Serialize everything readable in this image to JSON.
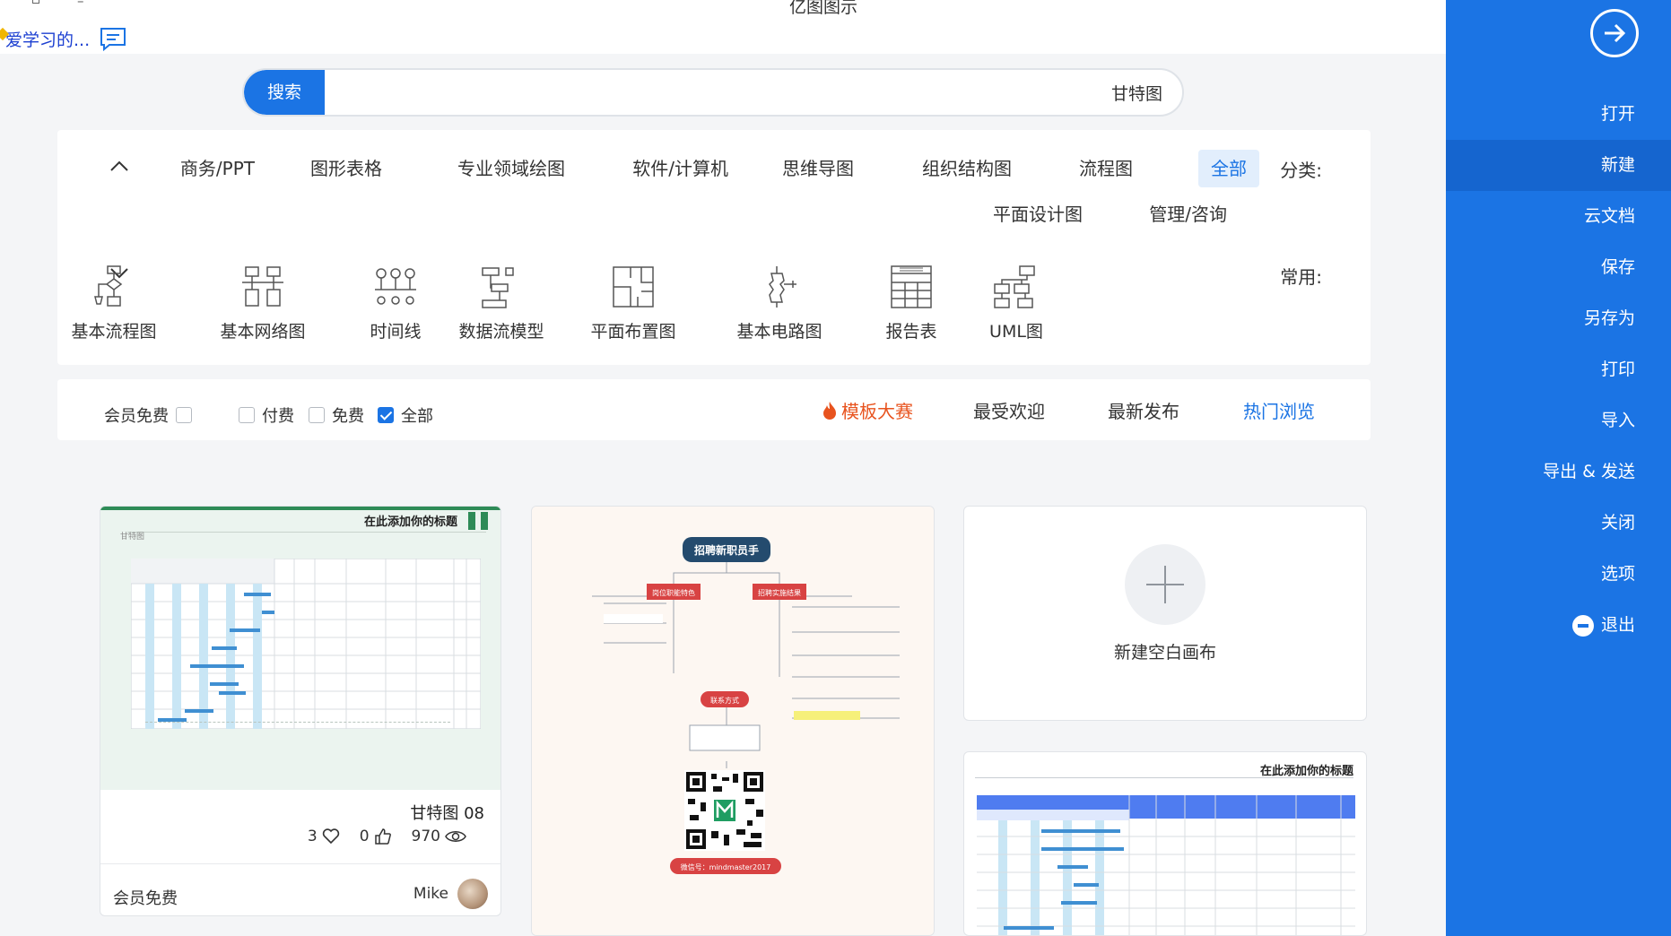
{
  "app": {
    "title": "亿图图示",
    "learn_link": "爱学习的..."
  },
  "sidebar": {
    "items": [
      {
        "label": "打开"
      },
      {
        "label": "新建"
      },
      {
        "label": "云文档"
      },
      {
        "label": "保存"
      },
      {
        "label": "另存为"
      },
      {
        "label": "打印"
      },
      {
        "label": "导入"
      },
      {
        "label": "导出 & 发送"
      },
      {
        "label": "关闭"
      },
      {
        "label": "选项"
      },
      {
        "label": "退出"
      }
    ],
    "active": "新建"
  },
  "search": {
    "button": "搜索",
    "value": "甘特图"
  },
  "categories": {
    "label": "分类:",
    "items": [
      "全部",
      "流程图",
      "组织结构图",
      "思维导图",
      "软件/计算机",
      "专业领域绘图",
      "图形表格",
      "商务/PPT",
      "管理/咨询",
      "平面设计图"
    ],
    "active": "全部"
  },
  "common": {
    "label": "常用:",
    "items": [
      {
        "label": "UML图",
        "icon": "uml-icon"
      },
      {
        "label": "报告表",
        "icon": "report-table-icon"
      },
      {
        "label": "基本电路图",
        "icon": "circuit-icon"
      },
      {
        "label": "平面布置图",
        "icon": "floor-plan-icon"
      },
      {
        "label": "数据流模型",
        "icon": "data-flow-icon"
      },
      {
        "label": "时间线",
        "icon": "timeline-icon"
      },
      {
        "label": "基本网络图",
        "icon": "network-icon"
      },
      {
        "label": "基本流程图",
        "icon": "flowchart-icon"
      }
    ]
  },
  "sort_tabs": [
    {
      "label": "热门浏览",
      "active": true
    },
    {
      "label": "最新发布"
    },
    {
      "label": "最受欢迎"
    },
    {
      "label": "模板大赛"
    }
  ],
  "price_filters": [
    {
      "label": "全部",
      "checked": true
    },
    {
      "label": "免费",
      "checked": false
    },
    {
      "label": "付费",
      "checked": false
    },
    {
      "label": "会员免费",
      "checked": false
    }
  ],
  "cards": {
    "blank": {
      "label": "新建空白画布"
    },
    "gantt": {
      "thumb_title": "在此添加你的标题",
      "thumb_subtitle": "甘特图",
      "title": "甘特图 08",
      "views": "970",
      "likes": "0",
      "favorites": "3",
      "author": "Mike",
      "price": "会员免费"
    },
    "mindmap": {
      "root": "招聘新职员手",
      "left1": "岗位职能特色",
      "right1": "招聘实施结果",
      "bottom": "联系方式",
      "qr_label": "微信号：mindmaster2017"
    },
    "gantt2": {
      "thumb_title": "在此添加你的标题"
    }
  },
  "colors": {
    "accent": "#1b74e4",
    "contest": "#e8531e",
    "gantt_green": "#2e8b57"
  }
}
